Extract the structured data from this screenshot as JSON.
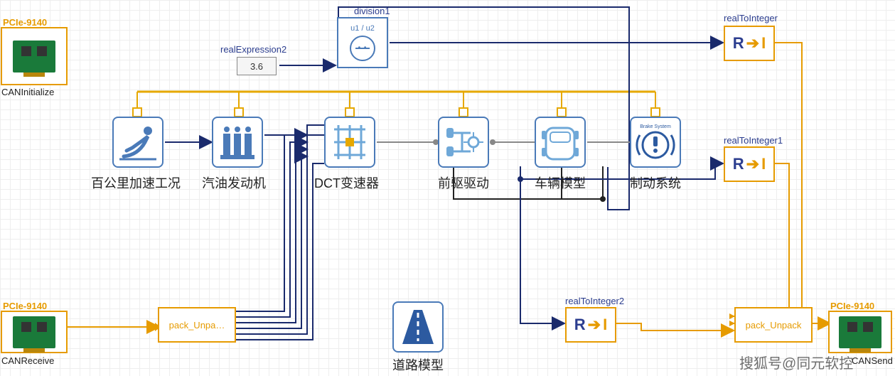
{
  "blocks": {
    "canInit": {
      "titleTop": "PCIe-9140",
      "labelBottom": "CANInitialize"
    },
    "canRecv": {
      "titleTop": "PCIe-9140",
      "labelBottom": "CANReceive"
    },
    "canSend": {
      "titleTop": "PCIe-9140",
      "labelBottom": "CANSend"
    },
    "packUnpack1": {
      "label": "pack_Unpa…"
    },
    "packUnpack2": {
      "label": "pack_Unpack"
    },
    "realExpr2": {
      "label": "realExpression2",
      "value": "3.6"
    },
    "division1": {
      "label": "division1",
      "innerLabel": "u1 / u2"
    },
    "r2i0": {
      "label": "realToInteger"
    },
    "r2i1": {
      "label": "realToInteger1"
    },
    "r2i2": {
      "label": "realToInteger2"
    },
    "accel": {
      "caption": "百公里加速工况"
    },
    "engine": {
      "caption": "汽油发动机"
    },
    "dct": {
      "caption": "DCT变速器"
    },
    "fwd": {
      "caption": "前驱驱动"
    },
    "vehicle": {
      "caption": "车辆模型"
    },
    "brake": {
      "caption": "制动系统",
      "inner": "Brake System"
    },
    "road": {
      "caption": "道路模型"
    }
  },
  "convertText": {
    "R": "R",
    "arrow": "➔",
    "I": "I"
  },
  "watermark": "搜狐号@同元软控"
}
